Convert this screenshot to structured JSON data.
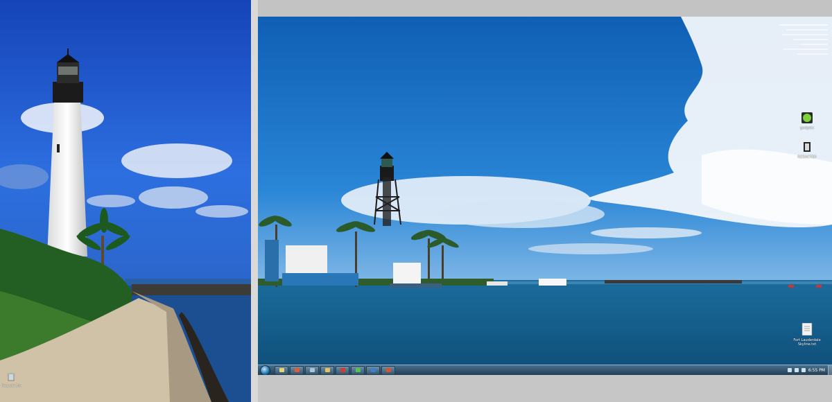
{
  "left_monitor": {
    "icons": [
      {
        "name": "recycle-bin",
        "label": "Recycle Bin"
      }
    ]
  },
  "right_monitor": {
    "icons": [
      {
        "name": "gadget-app",
        "label": "gadgets"
      },
      {
        "name": "program",
        "label": "REDACTED"
      },
      {
        "name": "text-file",
        "label": "Fort Lauderdale Skyline.txt"
      }
    ],
    "taskbar": {
      "buttons": [
        {
          "name": "explorer",
          "color": "#e9d27a"
        },
        {
          "name": "chrome",
          "color": "#e05a3a"
        },
        {
          "name": "explorer-2",
          "color": "#a8c5da"
        },
        {
          "name": "folder",
          "color": "#e7c45a"
        },
        {
          "name": "pdf",
          "color": "#d63a2f"
        },
        {
          "name": "app-green",
          "color": "#58c24c"
        },
        {
          "name": "app-blue",
          "color": "#3f7fd0"
        },
        {
          "name": "app-red",
          "color": "#d9532c"
        }
      ],
      "clock": "6:55 PM"
    }
  }
}
